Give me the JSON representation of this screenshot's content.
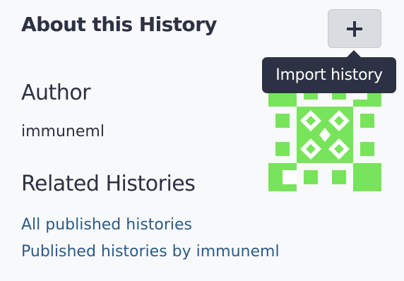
{
  "about": {
    "heading": "About this History",
    "import_button_symbol": "+",
    "import_tooltip": "Import history"
  },
  "author": {
    "title": "Author",
    "name": "immuneml",
    "avatar_color": "#78e45b"
  },
  "related": {
    "title": "Related Histories",
    "links": [
      {
        "label": "All published histories"
      },
      {
        "label": "Published histories by immuneml"
      }
    ]
  },
  "colors": {
    "text": "#2c3143",
    "link": "#2d5b85",
    "background": "#f8f9fa",
    "tooltip_bg": "#2c3143",
    "button_bg": "#d9dde2"
  }
}
